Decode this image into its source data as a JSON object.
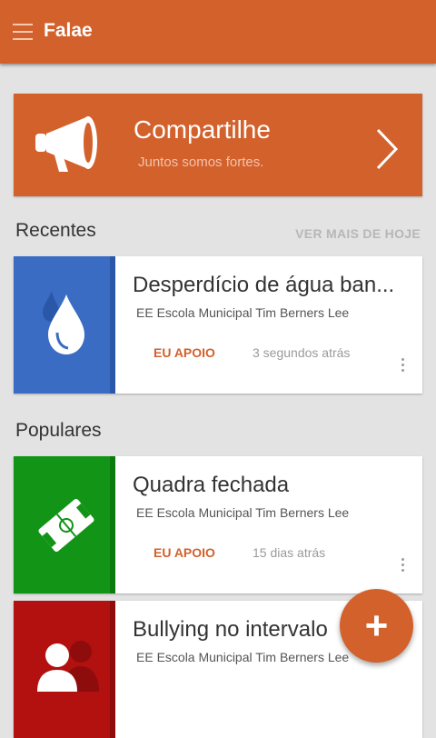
{
  "app": {
    "title": "Falae"
  },
  "banner": {
    "title": "Compartilhe",
    "subtitle": "Juntos somos fortes."
  },
  "recent": {
    "title": "Recentes",
    "see_more": "VER MAIS DE HOJE"
  },
  "popular": {
    "title": "Populares"
  },
  "cards": [
    {
      "title": "Desperdício de água ban...",
      "school": "EE Escola Municipal Tim Berners Lee",
      "support": "EU APOIO",
      "time": "3 segundos atrás",
      "color": "#3a6cc4",
      "stripe": "#2b57a8",
      "icon": "water-drop-icon"
    },
    {
      "title": "Quadra fechada",
      "school": "EE Escola Municipal Tim Berners Lee",
      "support": "EU APOIO",
      "time": "15 dias atrás",
      "color": "#129416",
      "stripe": "#0d7a10",
      "icon": "soccer-field-icon"
    },
    {
      "title": "Bullying no intervalo",
      "school": "EE Escola Municipal Tim Berners Lee",
      "color": "#b31010",
      "stripe": "#8f0c0c",
      "icon": "people-icon"
    }
  ],
  "fab": {
    "label": "+",
    "icon": "add-icon"
  },
  "colors": {
    "accent": "#d3612c",
    "background": "#e3e3e3"
  }
}
